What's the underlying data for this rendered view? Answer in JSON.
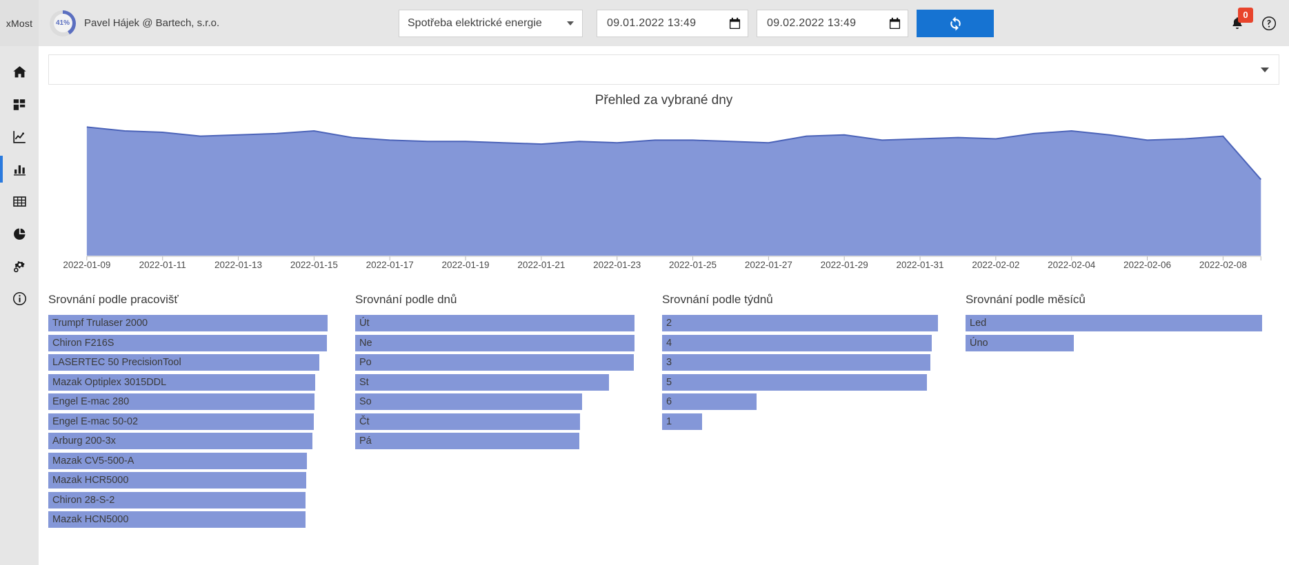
{
  "app": {
    "brand": "xMost",
    "accent": "#1673d2",
    "bar_color": "#8497d8",
    "area_fill": "#8497d8",
    "area_stroke": "#4a62b8"
  },
  "header": {
    "gauge_percent": "41%",
    "user_label": "Pavel Hájek @ Bartech, s.r.o.",
    "metric_select": {
      "value": "Spotřeba elektrické energie",
      "icon": "chevron-down-icon"
    },
    "date_from": {
      "value": "09.01.2022 13:49",
      "icon": "calendar-icon"
    },
    "date_to": {
      "value": "09.02.2022 13:49",
      "icon": "calendar-icon"
    },
    "refresh": {
      "icon": "refresh-icon",
      "label": ""
    },
    "notifications": {
      "icon": "bell-icon",
      "count": "0",
      "badge_color": "#e8442c"
    },
    "help": {
      "icon": "question-circle-icon"
    }
  },
  "sidebar": {
    "items": [
      {
        "icon": "home-icon",
        "name": "sidebar-item-home",
        "active": false
      },
      {
        "icon": "dashboard-grid-icon",
        "name": "sidebar-item-dashboard",
        "active": false
      },
      {
        "icon": "line-chart-icon",
        "name": "sidebar-item-line-chart",
        "active": false
      },
      {
        "icon": "bar-chart-icon",
        "name": "sidebar-item-bar-chart",
        "active": true
      },
      {
        "icon": "table-icon",
        "name": "sidebar-item-table",
        "active": false
      },
      {
        "icon": "pie-chart-icon",
        "name": "sidebar-item-pie-chart",
        "active": false
      },
      {
        "icon": "settings-gear-icon",
        "name": "sidebar-item-settings",
        "active": false
      },
      {
        "icon": "info-circle-icon",
        "name": "sidebar-item-info",
        "active": false
      }
    ]
  },
  "filter_panel": {
    "icon": "chevron-down-icon",
    "text": ""
  },
  "chart_data": [
    {
      "id": "overview-area",
      "type": "area",
      "title": "Přehled za vybrané dny",
      "xlabel": "",
      "ylabel": "",
      "grid": false,
      "legend": false,
      "x": [
        "2022-01-09",
        "2022-01-10",
        "2022-01-11",
        "2022-01-12",
        "2022-01-13",
        "2022-01-14",
        "2022-01-15",
        "2022-01-16",
        "2022-01-17",
        "2022-01-18",
        "2022-01-19",
        "2022-01-20",
        "2022-01-21",
        "2022-01-22",
        "2022-01-23",
        "2022-01-24",
        "2022-01-25",
        "2022-01-26",
        "2022-01-27",
        "2022-01-28",
        "2022-01-29",
        "2022-01-30",
        "2022-01-31",
        "2022-02-01",
        "2022-02-02",
        "2022-02-03",
        "2022-02-04",
        "2022-02-05",
        "2022-02-06",
        "2022-02-07",
        "2022-02-08",
        "2022-02-09"
      ],
      "tick_labels": [
        "2022-01-09",
        "2022-01-11",
        "2022-01-13",
        "2022-01-15",
        "2022-01-17",
        "2022-01-19",
        "2022-01-21",
        "2022-01-23",
        "2022-01-25",
        "2022-01-27",
        "2022-01-29",
        "2022-01-31",
        "2022-02-02",
        "2022-02-04",
        "2022-02-06",
        "2022-02-08"
      ],
      "values": [
        98,
        95,
        94,
        91,
        92,
        93,
        95,
        90,
        88,
        87,
        87,
        86,
        85,
        87,
        86,
        88,
        88,
        87,
        86,
        91,
        92,
        88,
        89,
        90,
        89,
        93,
        95,
        92,
        88,
        89,
        91,
        58
      ],
      "ylim": [
        0,
        105
      ]
    },
    {
      "id": "by-workplace",
      "type": "bar",
      "orientation": "horizontal",
      "title": "Srovnání podle pracovišť",
      "categories": [
        "Trumpf Trulaser 2000",
        "Chiron F216S",
        "LASERTEC 50 PrecisionTool",
        "Mazak Optiplex 3015DDL",
        "Engel E-mac 280",
        "Engel E-mac 50-02",
        "Arburg 200-3x",
        "Mazak CV5-500-A",
        "Mazak HCR5000",
        "Chiron 28-S-2",
        "Mazak HCN5000"
      ],
      "values": [
        100,
        99.8,
        97,
        95.6,
        95.3,
        95.1,
        94.6,
        92.6,
        92.4,
        92.2,
        92.0
      ],
      "max": 100
    },
    {
      "id": "by-day",
      "type": "bar",
      "orientation": "horizontal",
      "title": "Srovnání podle dnů",
      "categories": [
        "Út",
        "Ne",
        "Po",
        "St",
        "So",
        "Čt",
        "Pá"
      ],
      "values": [
        100,
        100,
        99.7,
        90.8,
        81.2,
        80.4,
        80.3
      ],
      "max": 100
    },
    {
      "id": "by-week",
      "type": "bar",
      "orientation": "horizontal",
      "title": "Srovnání podle týdnů",
      "categories": [
        "2",
        "4",
        "3",
        "5",
        "6",
        "1"
      ],
      "values": [
        100,
        97.7,
        97.3,
        96.1,
        34.2,
        14.6
      ],
      "max": 100
    },
    {
      "id": "by-month",
      "type": "bar",
      "orientation": "horizontal",
      "title": "Srovnání podle měsíců",
      "categories": [
        "Led",
        "Úno"
      ],
      "values": [
        100,
        36.4
      ],
      "max": 100
    }
  ]
}
